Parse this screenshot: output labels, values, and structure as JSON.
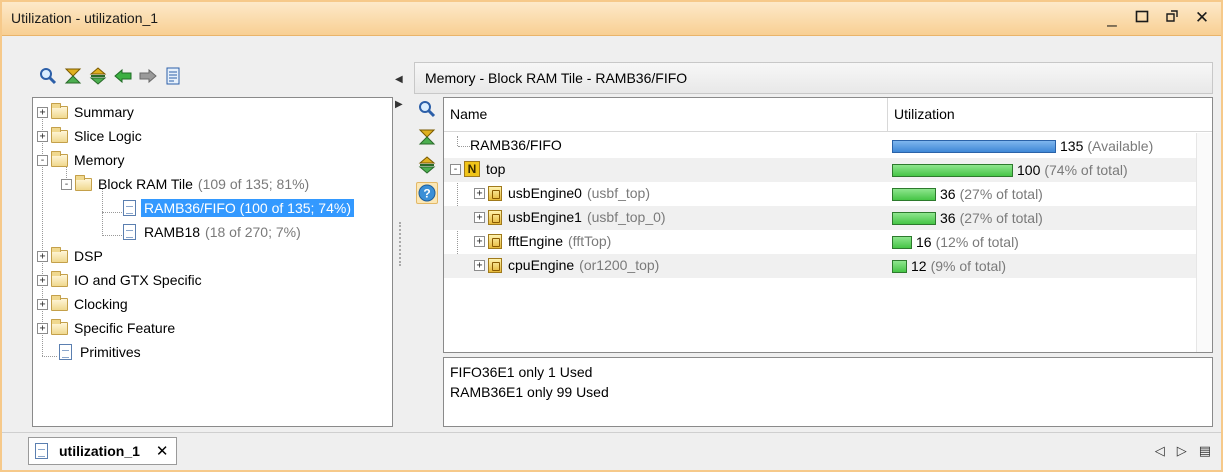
{
  "window": {
    "title": "Utilization - utilization_1",
    "controls": [
      "minimize",
      "maximize",
      "restore",
      "close"
    ]
  },
  "left_toolbar": {
    "icons": [
      "search-icon",
      "collapse-all-icon",
      "expand-all-icon",
      "back-arrow-icon",
      "forward-arrow-icon",
      "report-icon"
    ]
  },
  "tree": {
    "items": [
      {
        "label": "Summary",
        "detail": "",
        "type": "folder",
        "expander": "+"
      },
      {
        "label": "Slice Logic",
        "detail": "",
        "type": "folder",
        "expander": "+"
      },
      {
        "label": "Memory",
        "detail": "",
        "type": "folder",
        "expander": "-"
      },
      {
        "label": "Block RAM Tile",
        "detail": "(109 of 135; 81%)",
        "type": "folder",
        "expander": "-"
      },
      {
        "label": "RAMB36/FIFO (100 of 135; 74%)",
        "detail": "",
        "type": "page",
        "selected": true
      },
      {
        "label": "RAMB18",
        "detail": "(18 of 270; 7%)",
        "type": "page"
      },
      {
        "label": "DSP",
        "detail": "",
        "type": "folder",
        "expander": "+"
      },
      {
        "label": "IO and GTX Specific",
        "detail": "",
        "type": "folder",
        "expander": "+"
      },
      {
        "label": "Clocking",
        "detail": "",
        "type": "folder",
        "expander": "+"
      },
      {
        "label": "Specific Feature",
        "detail": "",
        "type": "folder",
        "expander": "+"
      },
      {
        "label": "Primitives",
        "detail": "",
        "type": "page"
      }
    ]
  },
  "right": {
    "header": "Memory - Block RAM Tile - RAMB36/FIFO",
    "side_icons": [
      "search-icon",
      "collapse-all-icon",
      "expand-all-icon",
      "help-icon"
    ],
    "columns": {
      "name": "Name",
      "utilization": "Utilization"
    },
    "rows": [
      {
        "name": "RAMB36/FIFO",
        "detail": "",
        "value": "135",
        "note": "(Available)",
        "fraction": 1.0,
        "color": "#3f88d6"
      },
      {
        "name": "top",
        "detail": "",
        "value": "100",
        "note": "(74% of total)",
        "fraction": 0.74,
        "color": "#46c546"
      },
      {
        "name": "usbEngine0",
        "detail": "(usbf_top)",
        "value": "36",
        "note": "(27% of total)",
        "fraction": 0.27,
        "color": "#46c546"
      },
      {
        "name": "usbEngine1",
        "detail": "(usbf_top_0)",
        "value": "36",
        "note": "(27% of total)",
        "fraction": 0.27,
        "color": "#46c546"
      },
      {
        "name": "fftEngine",
        "detail": "(fftTop)",
        "value": "16",
        "note": "(12% of total)",
        "fraction": 0.12,
        "color": "#46c546"
      },
      {
        "name": "cpuEngine",
        "detail": "(or1200_top)",
        "value": "12",
        "note": "(9% of total)",
        "fraction": 0.09,
        "color": "#46c546"
      }
    ],
    "info_lines": [
      "FIFO36E1 only 1 Used",
      "RAMB36E1 only 99 Used"
    ]
  },
  "bottom": {
    "tab_label": "utilization_1",
    "tab_close": "✕",
    "nav_prev": "◁",
    "nav_next": "▷",
    "nav_menu": "▤"
  }
}
